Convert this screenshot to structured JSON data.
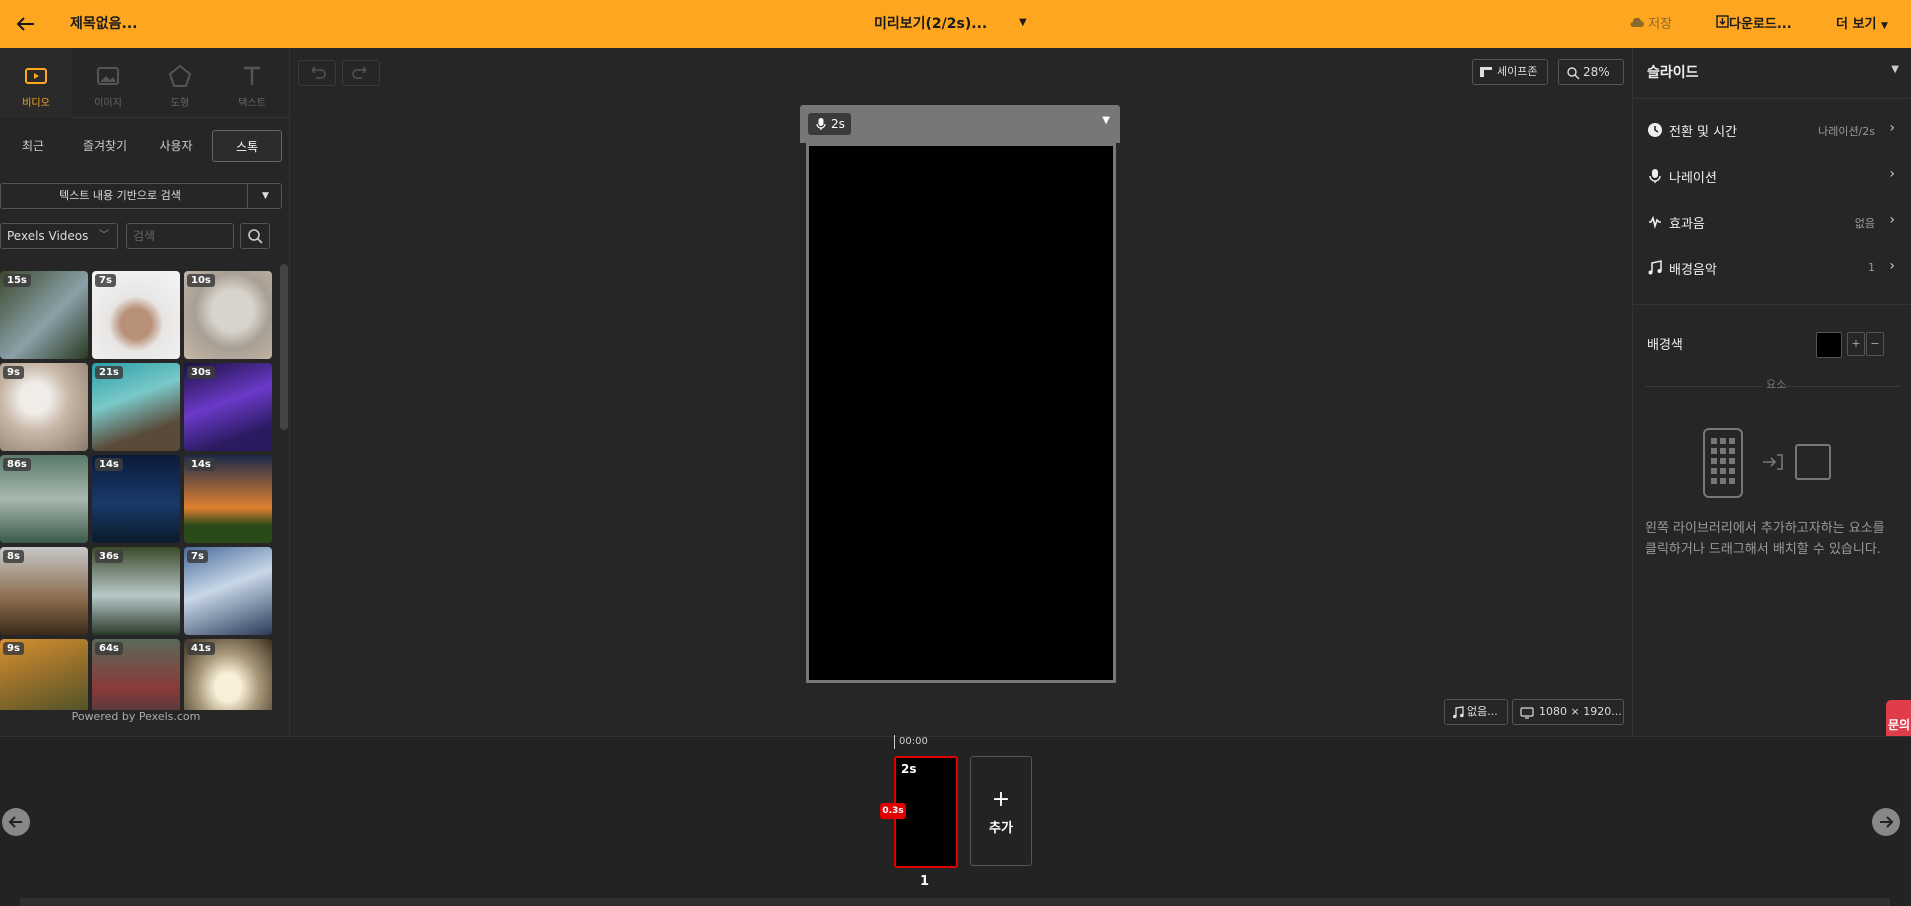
{
  "topbar": {
    "title": "제목없음...",
    "preview": "미리보기(2/2s)...",
    "save": "저장",
    "download": "다운로드...",
    "more": "더 보기"
  },
  "left_tabs": [
    {
      "label": "비디오",
      "icon": "video-icon",
      "active": true
    },
    {
      "label": "이미지",
      "icon": "image-icon",
      "active": false
    },
    {
      "label": "도형",
      "icon": "shape-icon",
      "active": false
    },
    {
      "label": "텍스트",
      "icon": "text-icon",
      "active": false
    }
  ],
  "sub_tabs": [
    "최근",
    "즐겨찾기",
    "사용자",
    "스톡"
  ],
  "search_mode": "텍스트 내용 기반으로 검색",
  "source": "Pexels Videos",
  "search_placeholder": "검색",
  "thumbnails": [
    "15s",
    "7s",
    "10s",
    "9s",
    "21s",
    "30s",
    "86s",
    "14s",
    "14s",
    "8s",
    "36s",
    "7s",
    "9s",
    "64s",
    "41s"
  ],
  "powered_by": "Powered by Pexels.com",
  "canvas": {
    "safe_zone": "세이프존",
    "zoom": "28%",
    "slide_duration": "2s",
    "bgm_status": "없음...",
    "resolution": "1080 × 1920..."
  },
  "right_panel": {
    "title": "슬라이드",
    "rows": [
      {
        "label": "전환 및 시간",
        "value": "나레이션/2s",
        "icon": "clock-icon"
      },
      {
        "label": "나레이션",
        "value": "",
        "icon": "microphone-icon"
      },
      {
        "label": "효과음",
        "value": "없음",
        "icon": "sound-effect-icon"
      },
      {
        "label": "배경음악",
        "value": "1",
        "icon": "music-icon"
      }
    ],
    "bg_color_label": "배경색",
    "bg_color_value": "#000000",
    "elements_label": "요소",
    "help_text": "왼쪽 라이브러리에서 추가하고자하는 요소를 클릭하거나 드래그해서 배치할 수 있습니다."
  },
  "inquiry": "문의",
  "timeline": {
    "time": "00:00",
    "slide_duration": "2s",
    "transition": "0.3s",
    "add_label": "추가",
    "slide_number": "1"
  },
  "colors": {
    "accent": "#ffa620",
    "selected": "#e00000",
    "inquiry": "#e03c4a"
  }
}
